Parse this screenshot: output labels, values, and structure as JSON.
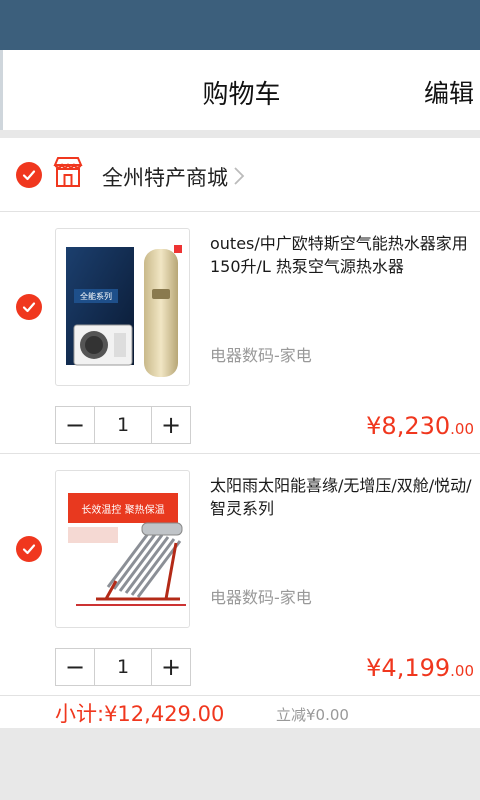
{
  "header": {
    "title": "购物车",
    "edit_label": "编辑"
  },
  "store": {
    "name": "全州特产商城",
    "icon": "store-icon"
  },
  "items": [
    {
      "title": "outes/中广欧特斯空气能热水器家用150升/L 热泵空气源热水器",
      "category": "电器数码-家电",
      "quantity": "1",
      "price_main": "¥8,230",
      "price_cents": ".00",
      "thumb_label": "全能系列"
    },
    {
      "title": "太阳雨太阳能喜缘/无增压/双舱/悦动/智灵系列",
      "category": "电器数码-家电",
      "quantity": "1",
      "price_main": "¥4,199",
      "price_cents": ".00",
      "thumb_label": "长效温控 聚热保温"
    }
  ],
  "summary": {
    "subtotal": "小计:¥12,429.00",
    "discount": "立减¥0.00"
  },
  "stepper": {
    "minus": "−",
    "plus": "+"
  },
  "colors": {
    "accent": "#f0371e",
    "status_bar": "#3c5f7c"
  }
}
